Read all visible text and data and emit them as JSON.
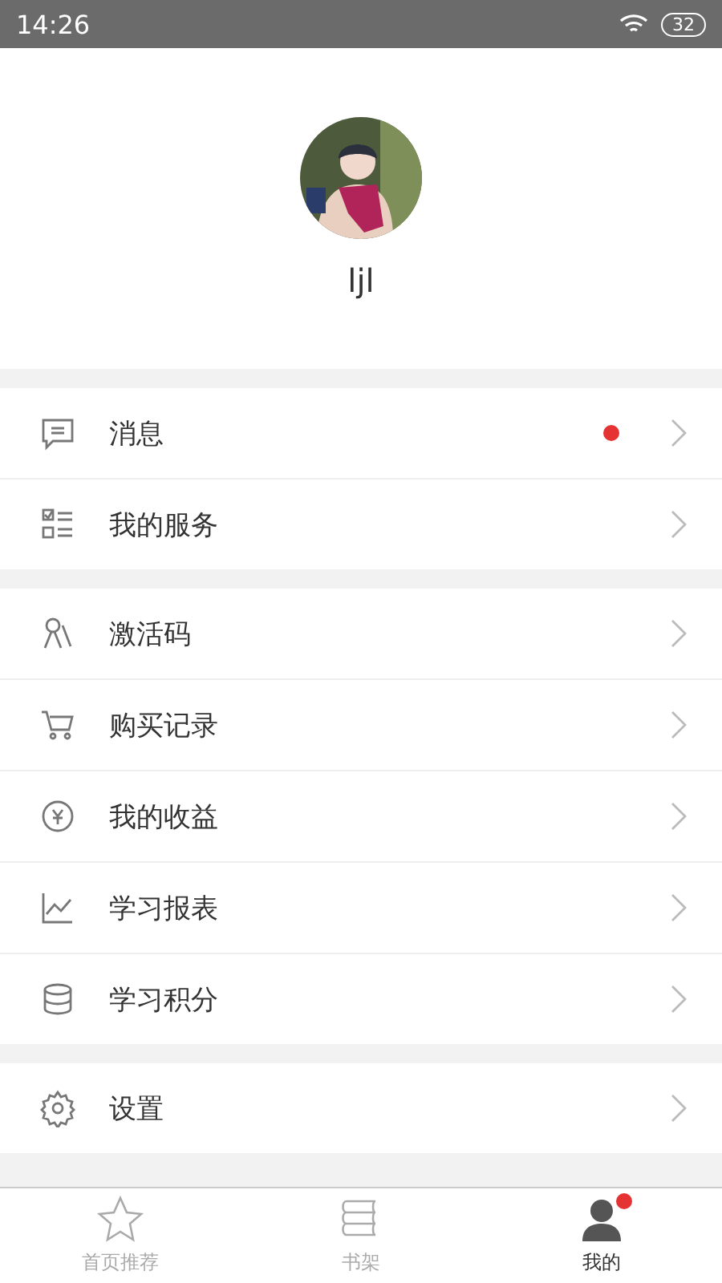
{
  "status_bar": {
    "time": "14:26",
    "battery": "32"
  },
  "profile": {
    "username": "ljl"
  },
  "menu_groups": [
    {
      "items": [
        {
          "kind": "message",
          "label": "消息",
          "dot": true
        },
        {
          "kind": "services",
          "label": "我的服务",
          "dot": false
        }
      ]
    },
    {
      "items": [
        {
          "kind": "keys",
          "label": "激活码",
          "dot": false
        },
        {
          "kind": "cart",
          "label": "购买记录",
          "dot": false
        },
        {
          "kind": "coin",
          "label": "我的收益",
          "dot": false
        },
        {
          "kind": "chart",
          "label": "学习报表",
          "dot": false
        },
        {
          "kind": "coins",
          "label": "学习积分",
          "dot": false
        }
      ]
    },
    {
      "items": [
        {
          "kind": "gear",
          "label": "设置",
          "dot": false
        }
      ]
    }
  ],
  "tab_bar": [
    {
      "kind": "star",
      "label": "首页推荐",
      "selected": false,
      "badge": false
    },
    {
      "kind": "bookshelf",
      "label": "书架",
      "selected": false,
      "badge": false
    },
    {
      "kind": "person",
      "label": "我的",
      "selected": true,
      "badge": true
    }
  ]
}
